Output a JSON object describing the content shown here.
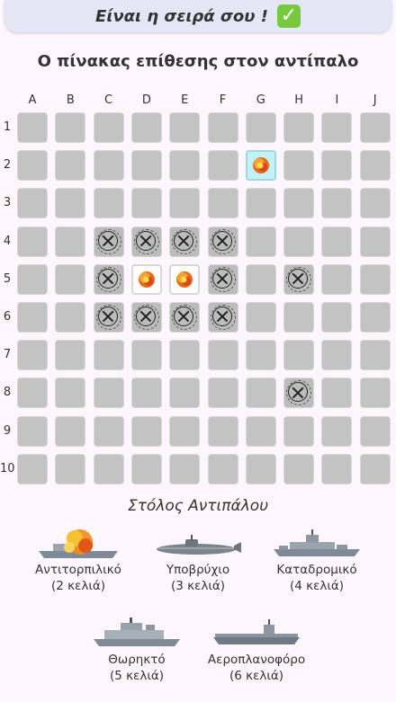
{
  "turn_banner": {
    "text": "Είναι η σειρά σου !",
    "check_icon": "check-mark-icon",
    "check_color": "#77c93f"
  },
  "board": {
    "title": "Ο πίνακας επίθεσης στον αντίπαλο",
    "columns": [
      "A",
      "B",
      "C",
      "D",
      "E",
      "F",
      "G",
      "H",
      "I",
      "J"
    ],
    "rows": [
      "1",
      "2",
      "3",
      "4",
      "5",
      "6",
      "7",
      "8",
      "9",
      "10"
    ],
    "marks": [
      {
        "cell": "G2",
        "state": "sunk-hit"
      },
      {
        "cell": "C4",
        "state": "miss"
      },
      {
        "cell": "D4",
        "state": "miss"
      },
      {
        "cell": "E4",
        "state": "miss"
      },
      {
        "cell": "F4",
        "state": "miss"
      },
      {
        "cell": "C5",
        "state": "miss"
      },
      {
        "cell": "D5",
        "state": "hit"
      },
      {
        "cell": "E5",
        "state": "hit"
      },
      {
        "cell": "F5",
        "state": "miss"
      },
      {
        "cell": "H5",
        "state": "miss"
      },
      {
        "cell": "C6",
        "state": "miss"
      },
      {
        "cell": "D6",
        "state": "miss"
      },
      {
        "cell": "E6",
        "state": "miss"
      },
      {
        "cell": "F6",
        "state": "miss"
      },
      {
        "cell": "H8",
        "state": "miss"
      }
    ]
  },
  "fleet": {
    "title": "Στόλος Αντιπάλου",
    "ships": [
      {
        "name": "Αντιτορπιλικό",
        "size": "(2 κελιά)",
        "sunk": true
      },
      {
        "name": "Υποβρύχιο",
        "size": "(3 κελιά)",
        "sunk": false
      },
      {
        "name": "Καταδρομικό",
        "size": "(4 κελιά)",
        "sunk": false
      },
      {
        "name": "Θωρηκτό",
        "size": "(5 κελιά)",
        "sunk": false
      },
      {
        "name": "Αεροπλανοφόρο",
        "size": "(6 κελιά)",
        "sunk": false
      }
    ]
  },
  "colors": {
    "cell": "#c3c3c3",
    "sunk_cell": "#c2f1f7",
    "hit_cell": "#ffffff",
    "banner": "#e6e7f6",
    "background": "#fdf6fc"
  }
}
